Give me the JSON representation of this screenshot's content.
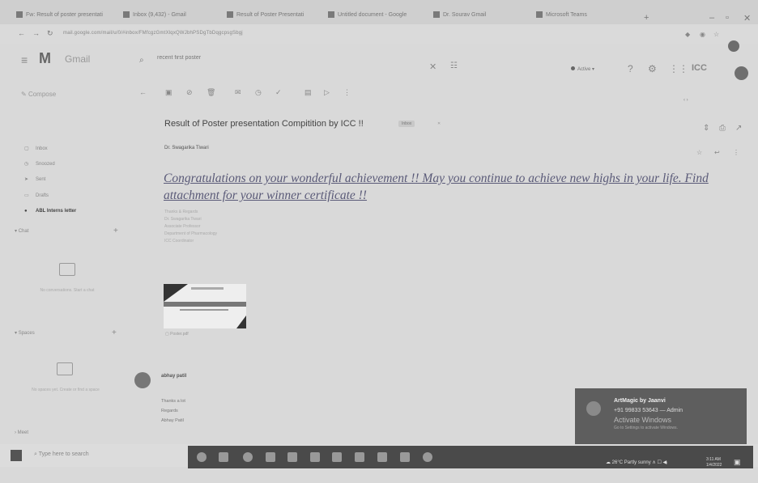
{
  "browser": {
    "tabs": [
      {
        "label": "Fw: Result of poster presentati"
      },
      {
        "label": "Inbox (9,432) - Gmail"
      },
      {
        "label": "Result of Poster Presentati"
      },
      {
        "label": "Untitled document - Google"
      },
      {
        "label": "Dr. Sourav Gmail"
      },
      {
        "label": "Microsoft Teams"
      }
    ],
    "url": "mail.google.com/mail/u/0/#inbox/FMfcgzGmtXlqxQWJbhPSDgTbDqgcpsgSbgj"
  },
  "gmail": {
    "app_name": "Gmail",
    "search": {
      "value": "recent first poster"
    },
    "status": "Active",
    "brand": "ICC"
  },
  "sidebar": {
    "compose": "Compose",
    "items": [
      {
        "label": "Inbox"
      },
      {
        "label": "Snoozed"
      },
      {
        "label": "Sent"
      },
      {
        "label": "Drafts"
      },
      {
        "label": "ABL Interns letter"
      }
    ],
    "chat_label": "Chat",
    "chat_placeholder": "No conversations. Start a chat",
    "spaces_label": "Spaces",
    "spaces_placeholder": "No spaces yet. Create or find a space",
    "meet_label": "Meet"
  },
  "mail": {
    "subject": "Result of Poster presentation Compitition by ICC !!",
    "chip": "Inbox",
    "sender": "Dr. Swagarika Tiwari",
    "message": "Congratulations on your wonderful achievement !! May you continue to achieve new highs in your life. Find attachment for your winner certificate !!",
    "signature": [
      "Thanks & Regards",
      "Dr. Swagarika Tiwari",
      "Associate Professor",
      "Department of Pharmacology",
      "ICC Coordinator"
    ],
    "attachment": "Poster.pdf"
  },
  "reply": {
    "name": "abhay patil",
    "lines": [
      "Thanks a lot",
      "Regards",
      "Abhay Patil"
    ]
  },
  "activate": {
    "title": "ArtMagic by Jaanvi",
    "subtitle": "+91 99833 53643 — Admin",
    "heading": "Activate Windows",
    "note": "Go to Settings to activate Windows."
  },
  "taskbar": {
    "search_placeholder": "Type here to search",
    "weather": "26°C Partly sunny",
    "time": "3:11 AM",
    "date": "1/4/2022"
  }
}
